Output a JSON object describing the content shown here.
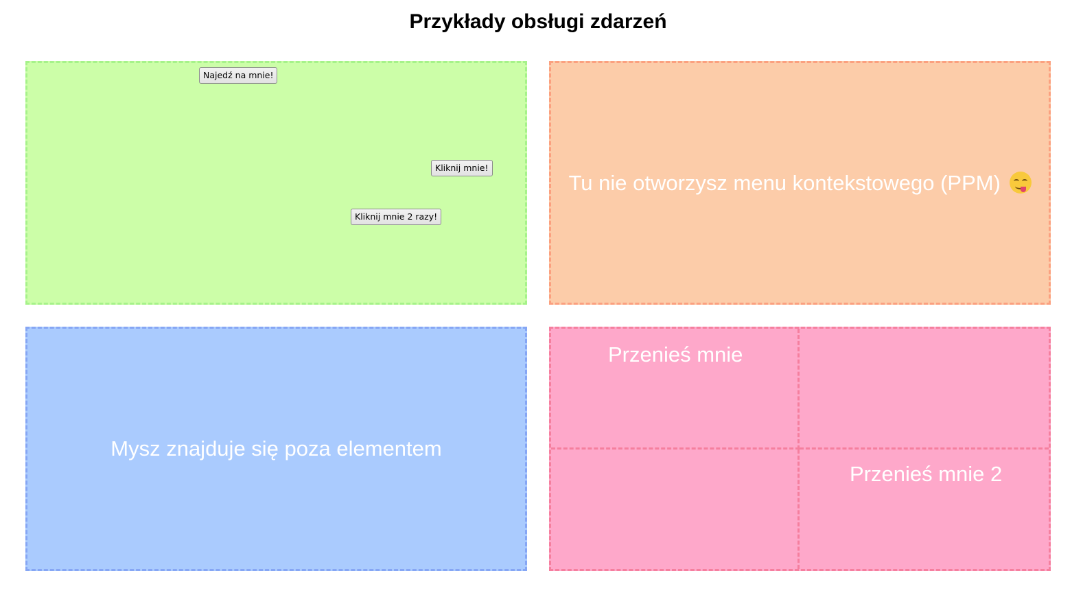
{
  "title": "Przykłady obsługi zdarzeń",
  "colors": {
    "panel_green_bg": "#ccfea8",
    "panel_green_border": "#a6f28a",
    "panel_orange_bg": "#fccca9",
    "panel_orange_border": "#fba07f",
    "panel_blue_bg": "#aacbfe",
    "panel_blue_border": "#86a6f4",
    "panel_pink_bg": "#fea8ca",
    "panel_pink_border": "#f57f9e"
  },
  "buttons_panel": {
    "hover_button": "Najedź na mnie!",
    "click_button": "Kliknij mnie!",
    "dblclick_button": "Kliknij mnie 2 razy!"
  },
  "contextmenu_panel": {
    "text": "Tu nie otworzysz menu kontekstowego (PPM)",
    "emoji_icon": "face-savoring-food-icon"
  },
  "hover_status_panel": {
    "text": "Mysz znajduje się poza elementem"
  },
  "dragdrop_panel": {
    "item_1": "Przenieś mnie",
    "item_2": "Przenieś mnie 2"
  }
}
